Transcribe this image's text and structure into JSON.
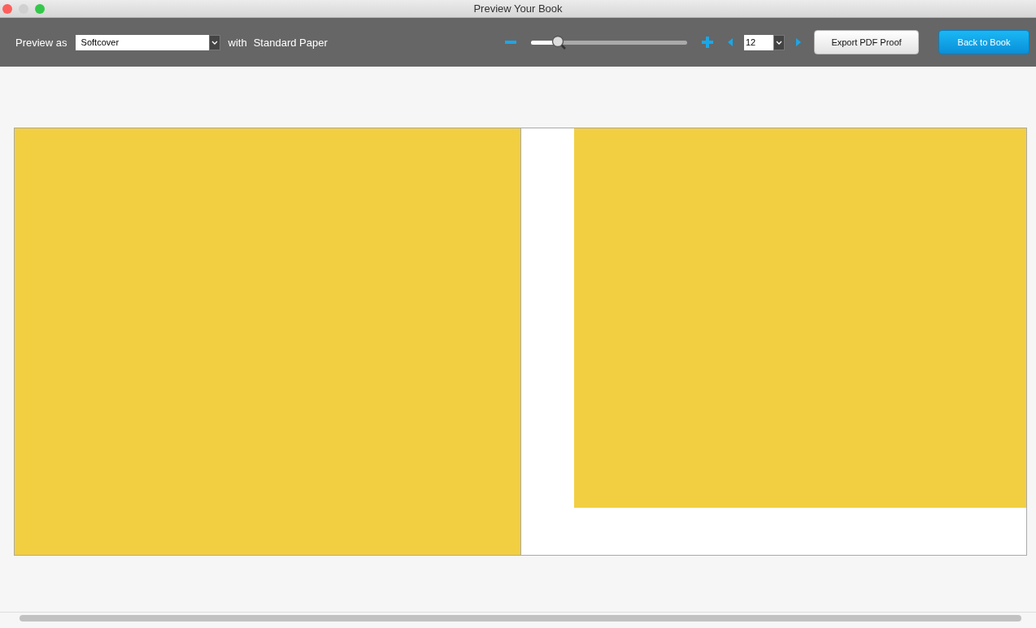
{
  "window": {
    "title": "Preview Your Book"
  },
  "toolbar": {
    "preview_label": "Preview as",
    "format": {
      "value": "Softcover"
    },
    "with_label": "with",
    "paper": "Standard Paper",
    "zoom": {
      "level": 0.17
    },
    "page": {
      "value": "12"
    },
    "buttons": [
      {
        "label": "Export PDF Proof",
        "kind": "secondary"
      },
      {
        "label": "Back to Book",
        "kind": "primary"
      }
    ]
  }
}
